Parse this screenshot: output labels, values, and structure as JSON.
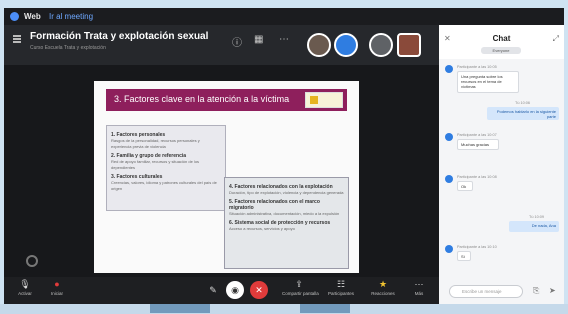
{
  "window": {
    "app_name": "Web",
    "app_link": "Ir al meeting"
  },
  "meeting": {
    "title": "Formación Trata y explotación sexual",
    "subtitle": "Curso Escuela Trata y explotación"
  },
  "slide": {
    "title": "3. Factores clave en la atención a la víctima",
    "left_box": [
      {
        "title": "1. Factores personales",
        "body": "Rasgos de la personalidad, recursos personales y experiencia previa de violencia"
      },
      {
        "title": "2. Familia y grupo de referencia",
        "body": "Red de apoyo familiar, recursos y situación de los dependientes"
      },
      {
        "title": "3. Factores culturales",
        "body": "Creencias, valores, idioma y patrones culturales del país de origen"
      }
    ],
    "right_box": [
      {
        "title": "4. Factores relacionados con la explotación",
        "body": "Duración, tipo de explotación, violencia y dependencia generada"
      },
      {
        "title": "5. Factores relacionados con el marco migratorio",
        "body": "Situación administrativa, documentación, miedo a la expulsión"
      },
      {
        "title": "6. Sistema social de protección y recursos",
        "body": "Acceso a recursos, servicios y apoyo"
      }
    ]
  },
  "toolbar": {
    "items": [
      {
        "icon": "mic-icon",
        "label": "Activar"
      },
      {
        "icon": "video-icon",
        "label": "Iniciar"
      },
      {
        "icon": "share-icon",
        "label": "Compartir pantalla"
      },
      {
        "icon": "participants-icon",
        "label": "Participantes"
      },
      {
        "icon": "reactions-icon",
        "label": "Reacciones"
      },
      {
        "icon": "more-icon",
        "label": "Más"
      }
    ],
    "leave_label": "✕"
  },
  "chat": {
    "title": "Chat",
    "subtitle": "Everyone",
    "messages": [
      {
        "name": "Participante a las 10:05",
        "text": "Una pregunta sobre los recursos en el tema de víctimas"
      },
      {
        "name": "Tú 10:06",
        "text": "Podemos hablarlo en la siguiente parte",
        "mine": true
      },
      {
        "name": "Participante a las 10:07",
        "text": "Muchas gracias"
      },
      {
        "name": "Participante a las 10:08",
        "text": "Ok"
      },
      {
        "name": "Tú 10:09",
        "text": "De nada, Ana",
        "mine": true
      },
      {
        "name": "Participante a las 10:10",
        "text": "Sí"
      }
    ],
    "input_placeholder": "Escribe un mensaje"
  },
  "colors": {
    "slide_header": "#8e1f5c",
    "accent_blue": "#2f7de1",
    "leave_red": "#e03b3b"
  }
}
